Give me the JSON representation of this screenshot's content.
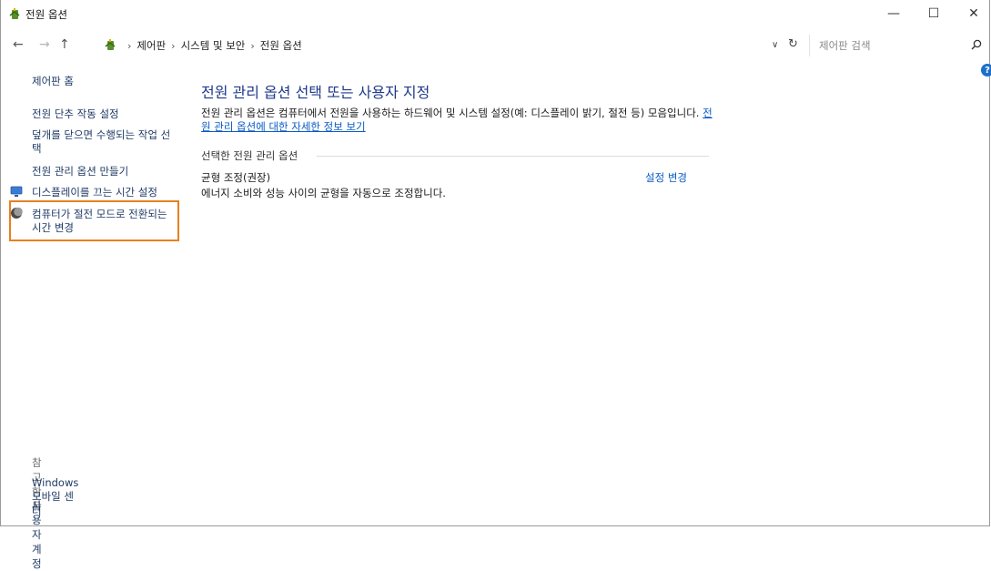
{
  "window": {
    "title": "전원 옵션",
    "minimize_glyph": "—",
    "maximize_glyph": "☐",
    "close_glyph": "✕"
  },
  "address": {
    "breadcrumb": [
      "제어판",
      "시스템 및 보안",
      "전원 옵션"
    ],
    "search_placeholder": "제어판 검색"
  },
  "sidebar": {
    "home": "제어판 홈",
    "links": [
      "전원 단추 작동 설정",
      "덮개를 닫으면 수행되는 작업 선택",
      "전원 관리 옵션 만들기",
      "디스플레이를 끄는 시간 설정",
      "컴퓨터가 절전 모드로 전환되는 시간 변경"
    ],
    "highlighted_index": 4,
    "see_also_heading": "참고 항목",
    "see_also": [
      "Windows 모바일 센터",
      "사용자 계정"
    ]
  },
  "main": {
    "title": "전원 관리 옵션 선택 또는 사용자 지정",
    "description": "전원 관리 옵션은 컴퓨터에서 전원을 사용하는 하드웨어 및 시스템 설정(예: 디스플레이 밝기, 절전 등) 모음입니다.",
    "description_link": "전원 관리 옵션에 대한 자세한 정보 보기",
    "section_label": "선택한 전원 관리 옵션",
    "plan": {
      "name": "균형 조정(권장)",
      "description": "에너지 소비와 성능 사이의 균형을 자동으로 조정합니다.",
      "change_link": "설정 변경"
    }
  },
  "icons": {
    "app": "power-options-icon",
    "display": "display-icon",
    "sleep": "moon-icon",
    "help": "help-icon"
  },
  "colors": {
    "link": "#1f3a64",
    "title": "#1e3a8a",
    "hyperlink": "#0a5bc4",
    "highlight": "#e8801f"
  }
}
